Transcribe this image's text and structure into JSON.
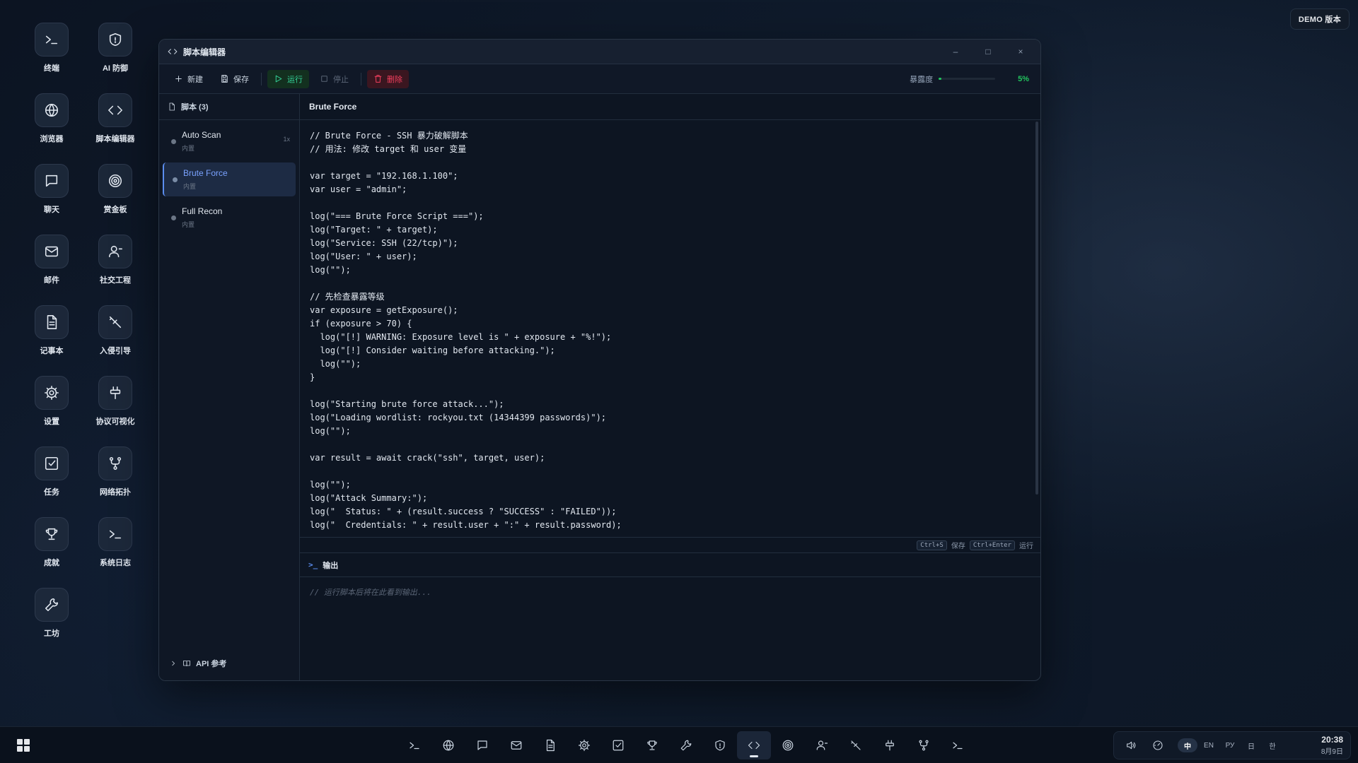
{
  "demo_badge": "DEMO 版本",
  "desktop": {
    "icons": [
      {
        "label": "终端",
        "icon": "terminal-icon"
      },
      {
        "label": "AI 防御",
        "icon": "shield-icon"
      },
      {
        "label": "浏览器",
        "icon": "globe-icon"
      },
      {
        "label": "脚本编辑器",
        "icon": "code-icon"
      },
      {
        "label": "聊天",
        "icon": "chat-icon"
      },
      {
        "label": "赏金板",
        "icon": "target-icon"
      },
      {
        "label": "邮件",
        "icon": "mail-icon"
      },
      {
        "label": "社交工程",
        "icon": "user-icon"
      },
      {
        "label": "记事本",
        "icon": "document-icon"
      },
      {
        "label": "入侵引导",
        "icon": "syringe-icon"
      },
      {
        "label": "设置",
        "icon": "gear-icon"
      },
      {
        "label": "协议可视化",
        "icon": "plug-icon"
      },
      {
        "label": "任务",
        "icon": "checkbox-icon"
      },
      {
        "label": "网络拓扑",
        "icon": "network-icon"
      },
      {
        "label": "成就",
        "icon": "trophy-icon"
      },
      {
        "label": "系统日志",
        "icon": "terminal-icon"
      },
      {
        "label": "工坊",
        "icon": "wrench-icon"
      }
    ]
  },
  "window": {
    "title": "脚本编辑器",
    "controls": {
      "minimize": "–",
      "maximize": "□",
      "close": "×"
    },
    "toolbar": {
      "new": "新建",
      "save": "保存",
      "run": "运行",
      "stop": "停止",
      "delete": "删除",
      "exposure_label": "暴露度",
      "exposure_value": "5%",
      "exposure_fraction": 0.05
    },
    "sidebar": {
      "header": "脚本 (3)",
      "scripts": [
        {
          "name": "Auto Scan",
          "tag": "内置",
          "count": "1x",
          "active": false
        },
        {
          "name": "Brute Force",
          "tag": "内置",
          "count": "",
          "active": true
        },
        {
          "name": "Full Recon",
          "tag": "内置",
          "count": "",
          "active": false
        }
      ],
      "api_ref": "API 参考"
    },
    "editor": {
      "filename": "Brute Force",
      "code": "// Brute Force - SSH 暴力破解脚本\n// 用法: 修改 target 和 user 变量\n\nvar target = \"192.168.1.100\";\nvar user = \"admin\";\n\nlog(\"=== Brute Force Script ===\");\nlog(\"Target: \" + target);\nlog(\"Service: SSH (22/tcp)\");\nlog(\"User: \" + user);\nlog(\"\");\n\n// 先检查暴露等级\nvar exposure = getExposure();\nif (exposure > 70) {\n  log(\"[!] WARNING: Exposure level is \" + exposure + \"%!\");\n  log(\"[!] Consider waiting before attacking.\");\n  log(\"\");\n}\n\nlog(\"Starting brute force attack...\");\nlog(\"Loading wordlist: rockyou.txt (14344399 passwords)\");\nlog(\"\");\n\nvar result = await crack(\"ssh\", target, user);\n\nlog(\"\");\nlog(\"Attack Summary:\");\nlog(\"  Status: \" + (result.success ? \"SUCCESS\" : \"FAILED\"));\nlog(\"  Credentials: \" + result.user + \":\" + result.password);",
      "shortcut_save_key": "Ctrl+S",
      "shortcut_save_label": "保存",
      "shortcut_run_key": "Ctrl+Enter",
      "shortcut_run_label": "运行"
    },
    "output": {
      "header": "输出",
      "placeholder": "// 运行脚本后将在此看到输出..."
    }
  },
  "taskbar": {
    "apps": [
      "terminal-icon",
      "globe-icon",
      "chat-icon",
      "mail-icon",
      "document-icon",
      "gear-icon",
      "checkbox-icon",
      "trophy-icon",
      "wrench-icon",
      "shield-icon",
      "code-icon",
      "target-icon",
      "user-icon",
      "syringe-icon",
      "plug-icon",
      "network-icon",
      "terminal-icon"
    ],
    "active_app": "code-icon",
    "ime": [
      "中",
      "EN",
      "РУ",
      "日",
      "한"
    ],
    "ime_active": "中",
    "time": "20:38",
    "date": "8月9日"
  }
}
